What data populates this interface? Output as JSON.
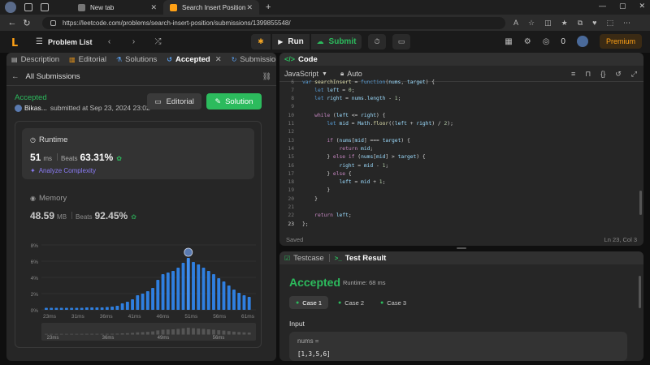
{
  "browser": {
    "tabs": [
      {
        "title": "New tab",
        "active": false
      },
      {
        "title": "Search Insert Position - LeetCode",
        "active": true
      }
    ],
    "url": "https://leetcode.com/problems/search-insert-position/submissions/1399855548/"
  },
  "topbar": {
    "problem_list": "Problem List",
    "run_label": "Run",
    "submit_label": "Submit",
    "notification_count": "0",
    "premium_label": "Premium"
  },
  "left_tabs": [
    "Description",
    "Editorial",
    "Solutions",
    "Accepted",
    "Submissions"
  ],
  "submission": {
    "back_label": "All Submissions",
    "status": "Accepted",
    "user": "Bikas...",
    "submitted_at": "submitted at Sep 23, 2024 23:02",
    "editorial_btn": "Editorial",
    "solution_btn": "Solution"
  },
  "runtime": {
    "title": "Runtime",
    "value": "51",
    "unit": "ms",
    "beats_label": "Beats",
    "percent": "63.31%",
    "analyze": "Analyze Complexity"
  },
  "memory": {
    "title": "Memory",
    "value": "48.59",
    "unit": "MB",
    "beats_label": "Beats",
    "percent": "92.45%"
  },
  "chart_data": {
    "type": "bar",
    "title": "",
    "xlabel": "",
    "ylabel": "",
    "y_ticks": [
      "8%",
      "6%",
      "4%",
      "2%",
      "0%"
    ],
    "ylim": [
      0,
      8
    ],
    "x_tick_labels": [
      "23ms",
      "31ms",
      "36ms",
      "41ms",
      "46ms",
      "51ms",
      "56ms",
      "61ms"
    ],
    "values": [
      0.25,
      0.25,
      0.25,
      0.25,
      0.25,
      0.25,
      0.25,
      0.25,
      0.3,
      0.3,
      0.3,
      0.3,
      0.35,
      0.4,
      0.5,
      0.8,
      1.0,
      1.3,
      1.8,
      2.0,
      2.3,
      2.7,
      3.7,
      4.4,
      4.6,
      4.8,
      5.2,
      5.8,
      6.4,
      5.9,
      5.6,
      5.2,
      4.8,
      4.4,
      3.9,
      3.5,
      3.0,
      2.5,
      2.1,
      1.8,
      1.6
    ],
    "highlight_index": 28,
    "overview_labels": [
      "23ms",
      "36ms",
      "49ms",
      "56ms"
    ]
  },
  "code": {
    "title": "Code",
    "language": "JavaScript",
    "mode": "Auto",
    "lines": [
      {
        "n": "6",
        "text": "var searchInsert = function(nums, target) {"
      },
      {
        "n": "7",
        "text": "    let left = 0;"
      },
      {
        "n": "8",
        "text": "    let right = nums.length - 1;"
      },
      {
        "n": "9",
        "text": ""
      },
      {
        "n": "10",
        "text": "    while (left <= right) {"
      },
      {
        "n": "11",
        "text": "        let mid = Math.floor((left + right) / 2);"
      },
      {
        "n": "12",
        "text": ""
      },
      {
        "n": "13",
        "text": "        if (nums[mid] === target) {"
      },
      {
        "n": "14",
        "text": "            return mid;"
      },
      {
        "n": "15",
        "text": "        } else if (nums[mid] > target) {"
      },
      {
        "n": "16",
        "text": "            right = mid - 1;"
      },
      {
        "n": "17",
        "text": "        } else {"
      },
      {
        "n": "18",
        "text": "            left = mid + 1;"
      },
      {
        "n": "19",
        "text": "        }"
      },
      {
        "n": "20",
        "text": "    }"
      },
      {
        "n": "21",
        "text": ""
      },
      {
        "n": "22",
        "text": "    return left;"
      },
      {
        "n": "23",
        "text": "};"
      }
    ],
    "saved": "Saved",
    "cursor": "Ln 23, Col 3"
  },
  "result": {
    "tabs": [
      "Testcase",
      "Test Result"
    ],
    "status": "Accepted",
    "runtime": "Runtime: 68 ms",
    "cases": [
      "Case 1",
      "Case 2",
      "Case 3"
    ],
    "input_label": "Input",
    "param_name": "nums =",
    "param_value": "[1,3,5,6]"
  }
}
